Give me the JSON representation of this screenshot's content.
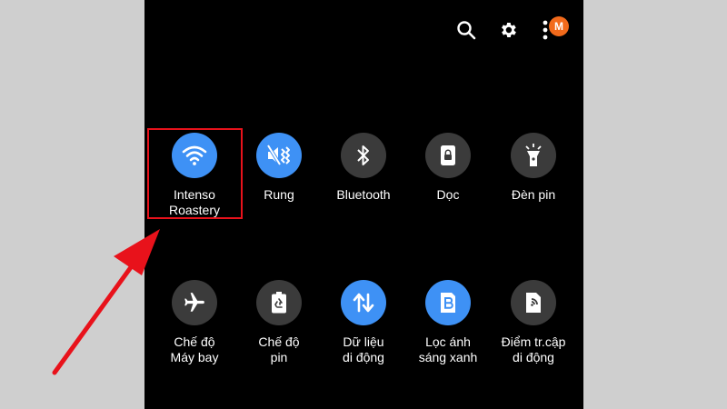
{
  "colors": {
    "active_tile": "#3e91f5",
    "inactive_tile": "#3b3b3b",
    "annotation": "#e8121b",
    "avatar": "#f26a1b"
  },
  "header": {
    "search_icon": "search-icon",
    "settings_icon": "gear-icon",
    "more_icon": "more-vertical-icon",
    "avatar_letter": "M"
  },
  "tiles": [
    {
      "label_line1": "Intenso",
      "label_line2": "Roastery",
      "icon": "wifi-icon",
      "active": true
    },
    {
      "label_line1": "Rung",
      "label_line2": "",
      "icon": "vibrate-icon",
      "active": true
    },
    {
      "label_line1": "Bluetooth",
      "label_line2": "",
      "icon": "bluetooth-icon",
      "active": false
    },
    {
      "label_line1": "Dọc",
      "label_line2": "",
      "icon": "portrait-lock-icon",
      "active": false
    },
    {
      "label_line1": "Đèn pin",
      "label_line2": "",
      "icon": "flashlight-icon",
      "active": false
    },
    {
      "label_line1": "Chế độ",
      "label_line2": "Máy bay",
      "icon": "airplane-icon",
      "active": false
    },
    {
      "label_line1": "Chế độ",
      "label_line2": "pin",
      "icon": "battery-recycle-icon",
      "active": false
    },
    {
      "label_line1": "Dữ liệu",
      "label_line2": "di động",
      "icon": "mobile-data-icon",
      "active": true
    },
    {
      "label_line1": "Lọc ánh",
      "label_line2": "sáng xanh",
      "icon": "blue-light-filter-icon",
      "active": true
    },
    {
      "label_line1": "Điểm tr.cập",
      "label_line2": "di động",
      "icon": "mobile-hotspot-icon",
      "active": false
    }
  ]
}
